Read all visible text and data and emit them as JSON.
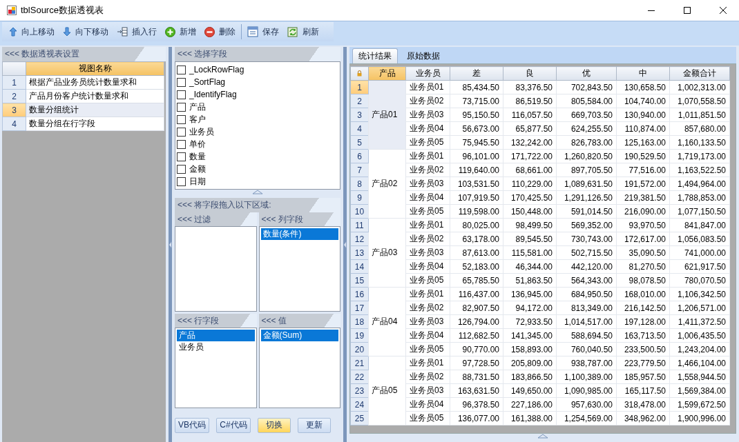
{
  "window": {
    "title": "tblSource数据透视表"
  },
  "toolbar": [
    {
      "kind": "up",
      "label": "向上移动",
      "separator_before": false
    },
    {
      "kind": "down",
      "label": "向下移动",
      "separator_before": false
    },
    {
      "kind": "insert",
      "label": "插入行",
      "separator_before": false
    },
    {
      "kind": "add",
      "label": "新增",
      "separator_before": false
    },
    {
      "kind": "delete",
      "label": "删除",
      "separator_before": false
    },
    {
      "kind": "save",
      "label": "保存",
      "separator_before": true
    },
    {
      "kind": "refresh",
      "label": "刷新",
      "separator_before": false
    }
  ],
  "settings_panel": {
    "title": "<<< 数据透视表设置",
    "column": "视图名称",
    "views": [
      {
        "no": "1",
        "name": "根据产品业务员统计数量求和",
        "selected": false
      },
      {
        "no": "2",
        "name": "产品月份客户统计数量求和",
        "selected": false
      },
      {
        "no": "3",
        "name": "数量分组统计",
        "selected": true
      },
      {
        "no": "4",
        "name": "数量分组在行字段",
        "selected": false
      }
    ]
  },
  "fields_panel": {
    "title": "<<< 选择字段",
    "fields": [
      {
        "label": "_LockRowFlag",
        "checked": false
      },
      {
        "label": "_SortFlag",
        "checked": false
      },
      {
        "label": "_IdentifyFlag",
        "checked": false
      },
      {
        "label": "产品",
        "checked": false
      },
      {
        "label": "客户",
        "checked": false
      },
      {
        "label": "业务员",
        "checked": false
      },
      {
        "label": "单价",
        "checked": false
      },
      {
        "label": "数量",
        "checked": false
      },
      {
        "label": "金额",
        "checked": false
      },
      {
        "label": "日期",
        "checked": false
      }
    ],
    "drop_title": "<<< 将字段拖入以下区域:",
    "zones": [
      {
        "title": "<<< 过滤"
      },
      {
        "title": "<<< 列字段",
        "items": [
          {
            "label": "数量(条件)",
            "selected": true
          }
        ]
      },
      {
        "title": "<<< 行字段",
        "items": [
          {
            "label": "产品",
            "selected": true
          },
          {
            "label": "业务员",
            "selected": false
          }
        ]
      },
      {
        "title": "<<< 值",
        "items": [
          {
            "label": "金额(Sum)",
            "selected": true
          }
        ]
      }
    ],
    "buttons": [
      {
        "label": "VB代码",
        "highlighted": false
      },
      {
        "label": "C#代码",
        "highlighted": false
      },
      {
        "label": "切换",
        "highlighted": true
      },
      {
        "label": "更新",
        "highlighted": false
      }
    ]
  },
  "result": {
    "tabs": [
      {
        "label": "统计结果",
        "selected": true
      },
      {
        "label": "原始数据",
        "selected": false
      }
    ],
    "columns": [
      "产品",
      "业务员",
      "差",
      "良",
      "优",
      "中",
      "金额合计"
    ],
    "groups": [
      {
        "product": "产品01",
        "rows": [
          {
            "no": "1",
            "selected": true,
            "person": "业务员01",
            "values": [
              "85,434.50",
              "83,376.50",
              "702,843.50",
              "130,658.50",
              "1,002,313.00"
            ]
          },
          {
            "no": "2",
            "selected": false,
            "person": "业务员02",
            "values": [
              "73,715.00",
              "86,519.50",
              "805,584.00",
              "104,740.00",
              "1,070,558.50"
            ]
          },
          {
            "no": "3",
            "selected": false,
            "person": "业务员03",
            "values": [
              "95,150.50",
              "116,057.50",
              "669,703.50",
              "130,940.00",
              "1,011,851.50"
            ]
          },
          {
            "no": "4",
            "selected": false,
            "person": "业务员04",
            "values": [
              "56,673.00",
              "65,877.50",
              "624,255.50",
              "110,874.00",
              "857,680.00"
            ]
          },
          {
            "no": "5",
            "selected": false,
            "person": "业务员05",
            "values": [
              "75,945.50",
              "132,242.00",
              "826,783.00",
              "125,163.00",
              "1,160,133.50"
            ]
          }
        ]
      },
      {
        "product": "产品02",
        "rows": [
          {
            "no": "6",
            "selected": false,
            "person": "业务员01",
            "values": [
              "96,101.00",
              "171,722.00",
              "1,260,820.50",
              "190,529.50",
              "1,719,173.00"
            ]
          },
          {
            "no": "7",
            "selected": false,
            "person": "业务员02",
            "values": [
              "119,640.00",
              "68,661.00",
              "897,705.50",
              "77,516.00",
              "1,163,522.50"
            ]
          },
          {
            "no": "8",
            "selected": false,
            "person": "业务员03",
            "values": [
              "103,531.50",
              "110,229.00",
              "1,089,631.50",
              "191,572.00",
              "1,494,964.00"
            ]
          },
          {
            "no": "9",
            "selected": false,
            "person": "业务员04",
            "values": [
              "107,919.50",
              "170,425.50",
              "1,291,126.50",
              "219,381.50",
              "1,788,853.00"
            ]
          },
          {
            "no": "10",
            "selected": false,
            "person": "业务员05",
            "values": [
              "119,598.00",
              "150,448.00",
              "591,014.50",
              "216,090.00",
              "1,077,150.50"
            ]
          }
        ]
      },
      {
        "product": "产品03",
        "rows": [
          {
            "no": "11",
            "selected": false,
            "person": "业务员01",
            "values": [
              "80,025.00",
              "98,499.50",
              "569,352.00",
              "93,970.50",
              "841,847.00"
            ]
          },
          {
            "no": "12",
            "selected": false,
            "person": "业务员02",
            "values": [
              "63,178.00",
              "89,545.50",
              "730,743.00",
              "172,617.00",
              "1,056,083.50"
            ]
          },
          {
            "no": "13",
            "selected": false,
            "person": "业务员03",
            "values": [
              "87,613.00",
              "115,581.00",
              "502,715.50",
              "35,090.50",
              "741,000.00"
            ]
          },
          {
            "no": "14",
            "selected": false,
            "person": "业务员04",
            "values": [
              "52,183.00",
              "46,344.00",
              "442,120.00",
              "81,270.50",
              "621,917.50"
            ]
          },
          {
            "no": "15",
            "selected": false,
            "person": "业务员05",
            "values": [
              "65,785.50",
              "51,863.50",
              "564,343.00",
              "98,078.50",
              "780,070.50"
            ]
          }
        ]
      },
      {
        "product": "产品04",
        "rows": [
          {
            "no": "16",
            "selected": false,
            "person": "业务员01",
            "values": [
              "116,437.00",
              "136,945.00",
              "684,950.50",
              "168,010.00",
              "1,106,342.50"
            ]
          },
          {
            "no": "17",
            "selected": false,
            "person": "业务员02",
            "values": [
              "82,907.50",
              "94,172.00",
              "813,349.00",
              "216,142.50",
              "1,206,571.00"
            ]
          },
          {
            "no": "18",
            "selected": false,
            "person": "业务员03",
            "values": [
              "126,794.00",
              "72,933.50",
              "1,014,517.00",
              "197,128.00",
              "1,411,372.50"
            ]
          },
          {
            "no": "19",
            "selected": false,
            "person": "业务员04",
            "values": [
              "112,682.50",
              "141,345.00",
              "588,694.50",
              "163,713.50",
              "1,006,435.50"
            ]
          },
          {
            "no": "20",
            "selected": false,
            "person": "业务员05",
            "values": [
              "90,770.00",
              "158,893.00",
              "760,040.50",
              "233,500.50",
              "1,243,204.00"
            ]
          }
        ]
      },
      {
        "product": "产品05",
        "rows": [
          {
            "no": "21",
            "selected": false,
            "person": "业务员01",
            "values": [
              "97,728.50",
              "205,809.00",
              "938,787.00",
              "223,779.50",
              "1,466,104.00"
            ]
          },
          {
            "no": "22",
            "selected": false,
            "person": "业务员02",
            "values": [
              "88,731.50",
              "183,866.50",
              "1,100,389.00",
              "185,957.50",
              "1,558,944.50"
            ]
          },
          {
            "no": "23",
            "selected": false,
            "person": "业务员03",
            "values": [
              "163,631.50",
              "149,650.00",
              "1,090,985.00",
              "165,117.50",
              "1,569,384.00"
            ]
          },
          {
            "no": "24",
            "selected": false,
            "person": "业务员04",
            "values": [
              "96,378.50",
              "227,186.00",
              "957,630.00",
              "318,478.00",
              "1,599,672.50"
            ]
          },
          {
            "no": "25",
            "selected": false,
            "person": "业务员05",
            "values": [
              "136,077.00",
              "161,388.00",
              "1,254,569.00",
              "348,962.00",
              "1,900,996.00"
            ]
          }
        ]
      }
    ]
  }
}
